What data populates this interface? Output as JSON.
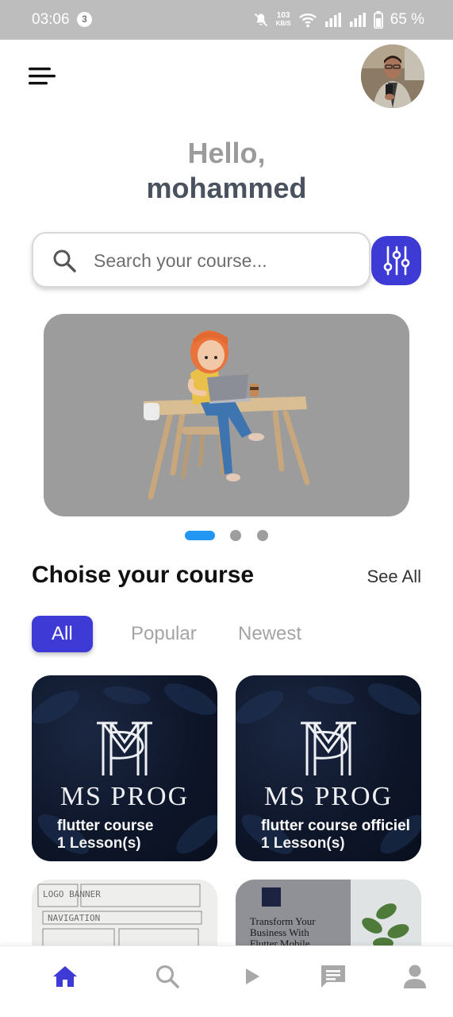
{
  "status_bar": {
    "time": "03:06",
    "notification_count": "3",
    "net_speed_value": "103",
    "net_speed_unit": "KB/S",
    "battery_percent": "65 %"
  },
  "header": {
    "menu_icon": "menu-icon",
    "avatar_icon": "avatar"
  },
  "greeting": {
    "hello": "Hello,",
    "name": "mohammed"
  },
  "search": {
    "placeholder": "Search your course...",
    "value": "",
    "filter_icon": "sliders-icon"
  },
  "carousel": {
    "pages": 3,
    "active_index": 0
  },
  "courses_section": {
    "title": "Choise your course",
    "see_all": "See All",
    "tabs": [
      {
        "label": "All",
        "active": true
      },
      {
        "label": "Popular",
        "active": false
      },
      {
        "label": "Newest",
        "active": false
      }
    ]
  },
  "courses": [
    {
      "brand": "MS PROG",
      "title": "flutter course",
      "lessons": "1 Lesson(s)"
    },
    {
      "brand": "MS PROG",
      "title": "flutter course officiel",
      "lessons": "1 Lesson(s)"
    },
    {
      "sketch_lines": [
        "LOGO   BANNER",
        "NAVIGATION"
      ]
    },
    {
      "promo_text": "Transform Your Business With Flutter Mobile"
    }
  ],
  "bottom_nav": [
    {
      "icon": "home-icon",
      "active": true
    },
    {
      "icon": "search-icon",
      "active": false
    },
    {
      "icon": "play-icon",
      "active": false
    },
    {
      "icon": "chat-icon",
      "active": false
    },
    {
      "icon": "person-icon",
      "active": false
    }
  ],
  "colors": {
    "accent": "#3d3ad6",
    "dot_active": "#2196f3",
    "status_bar": "#bdbdbd"
  }
}
